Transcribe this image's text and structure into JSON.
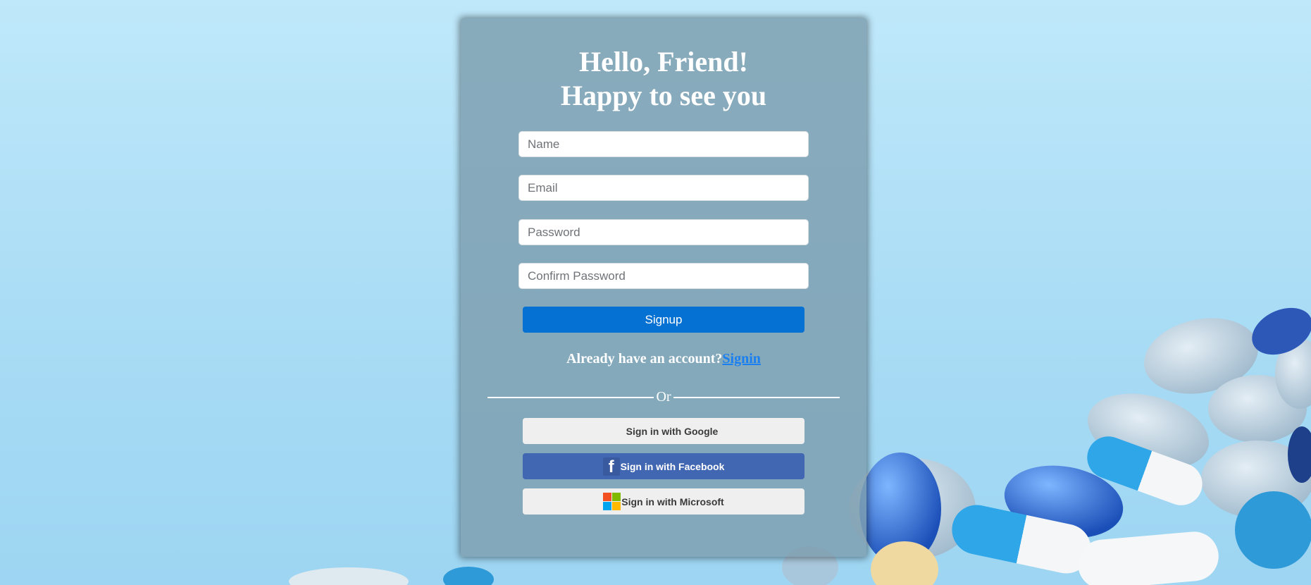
{
  "colors": {
    "card_bg": "#7d9eaf",
    "signup_bg": "#0571d3",
    "facebook_bg": "#4267b2",
    "social_light_bg": "#efeff0",
    "link": "#1a7ff0",
    "ms_red": "#f25022",
    "ms_green": "#7fba00",
    "ms_blue": "#00a4ef",
    "ms_yellow": "#ffb900"
  },
  "heading": {
    "line1": "Hello, Friend!",
    "line2": "Happy to see you"
  },
  "form": {
    "name_placeholder": "Name",
    "email_placeholder": "Email",
    "password_placeholder": "Password",
    "confirm_placeholder": "Confirm Password",
    "signup_label": "Signup"
  },
  "account": {
    "prompt": "Already have an account?",
    "link": "Signin"
  },
  "divider": {
    "text": "Or"
  },
  "social": {
    "google": "Sign in with Google",
    "facebook": "Sign in with Facebook",
    "facebook_icon": "facebook-logo-icon",
    "microsoft": "Sign in with Microsoft",
    "microsoft_icon": "microsoft-logo-icon"
  }
}
